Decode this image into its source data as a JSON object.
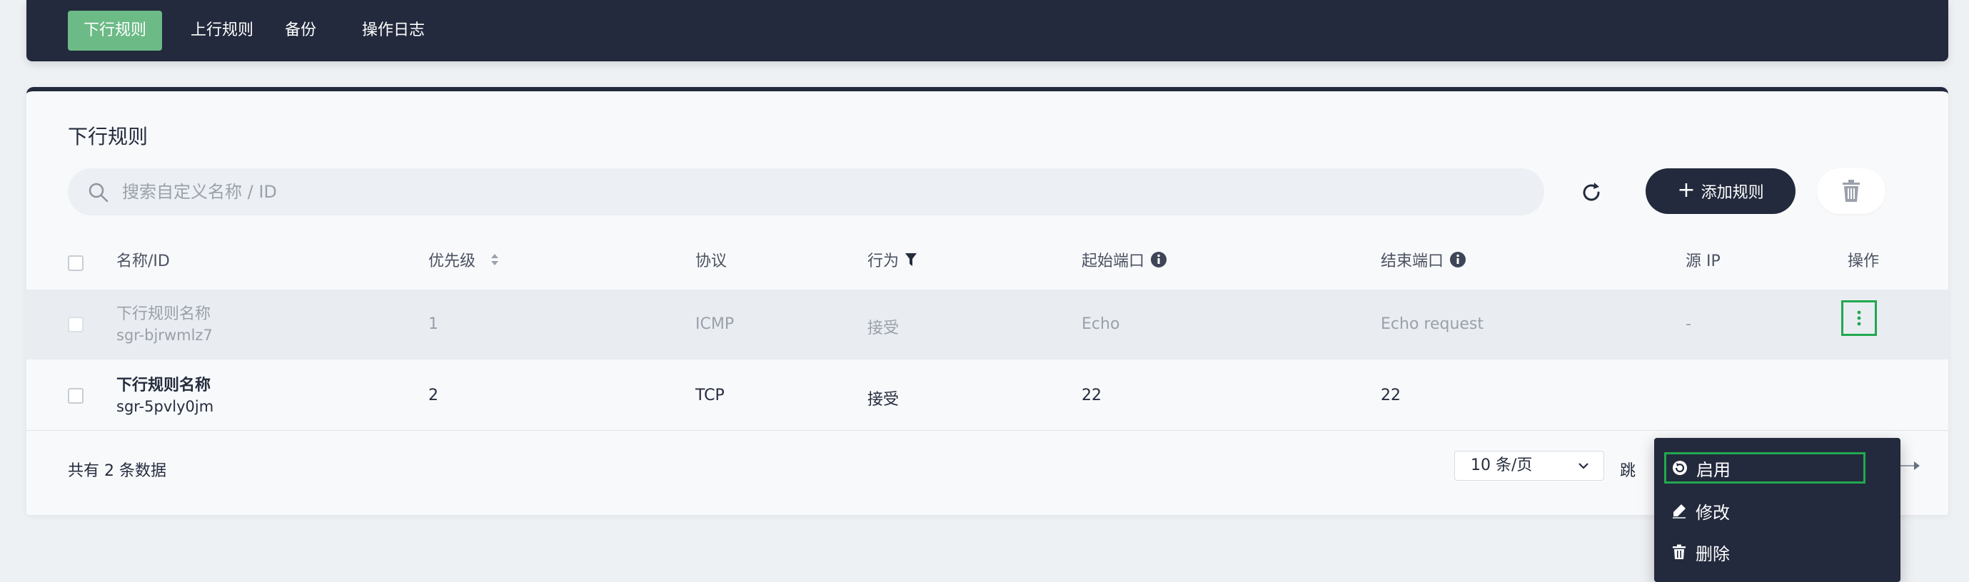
{
  "tabs": [
    {
      "label": "下行规则",
      "active": true
    },
    {
      "label": "上行规则",
      "active": false
    },
    {
      "label": "备份",
      "active": false
    },
    {
      "label": "操作日志",
      "active": false
    }
  ],
  "panel": {
    "title": "下行规则",
    "search_placeholder": "搜索自定义名称 / ID",
    "add_button_label": "添加规则"
  },
  "table": {
    "columns": {
      "name": "名称/ID",
      "priority": "优先级",
      "protocol": "协议",
      "action": "行为",
      "start_port": "起始端口",
      "end_port": "结束端口",
      "source_ip": "源 IP",
      "operations": "操作"
    },
    "rows": [
      {
        "name": "下行规则名称",
        "id": "sgr-bjrwmlz7",
        "priority": "1",
        "protocol": "ICMP",
        "action": "接受",
        "start_port": "Echo",
        "end_port": "Echo request",
        "source_ip": "-",
        "disabled": true
      },
      {
        "name": "下行规则名称",
        "id": "sgr-5pvly0jm",
        "priority": "2",
        "protocol": "TCP",
        "action": "接受",
        "start_port": "22",
        "end_port": "22",
        "source_ip": "",
        "disabled": false
      }
    ]
  },
  "footer": {
    "count_text": "共有 2 条数据",
    "page_size": "10 条/页",
    "jump_label": "跳"
  },
  "context_menu": {
    "items": [
      {
        "label": "启用",
        "icon": "enable-icon",
        "focused": true
      },
      {
        "label": "修改",
        "icon": "edit-icon",
        "focused": false
      },
      {
        "label": "删除",
        "icon": "delete-icon",
        "focused": false
      }
    ]
  },
  "colors": {
    "dark": "#232a3d",
    "accent_green": "#6cba86",
    "focus_green": "#22a84f"
  }
}
